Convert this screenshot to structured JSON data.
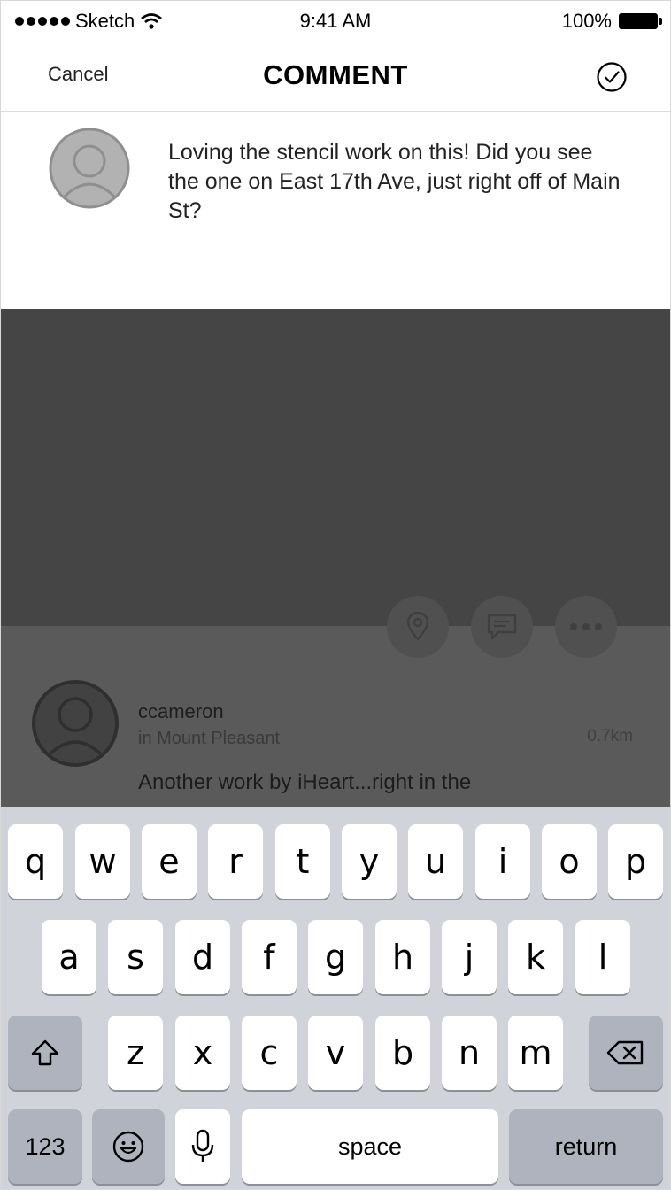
{
  "status_bar": {
    "carrier": "Sketch",
    "time": "9:41 AM",
    "battery": "100%"
  },
  "nav": {
    "cancel_label": "Cancel",
    "title": "COMMENT"
  },
  "comment": {
    "text": "Loving the stencil work on this! Did you see the one on East 17th Ave, just right off of Main St?"
  },
  "post": {
    "username": "ccameron",
    "location": "in Mount Pleasant",
    "distance": "0.7km",
    "snippet": "Another work by iHeart...right in the"
  },
  "keyboard": {
    "row1": [
      "q",
      "w",
      "e",
      "r",
      "t",
      "y",
      "u",
      "i",
      "o",
      "p"
    ],
    "row2": [
      "a",
      "s",
      "d",
      "f",
      "g",
      "h",
      "j",
      "k",
      "l"
    ],
    "row3": [
      "z",
      "x",
      "c",
      "v",
      "b",
      "n",
      "m"
    ],
    "numbers_label": "123",
    "space_label": "space",
    "return_label": "return"
  }
}
